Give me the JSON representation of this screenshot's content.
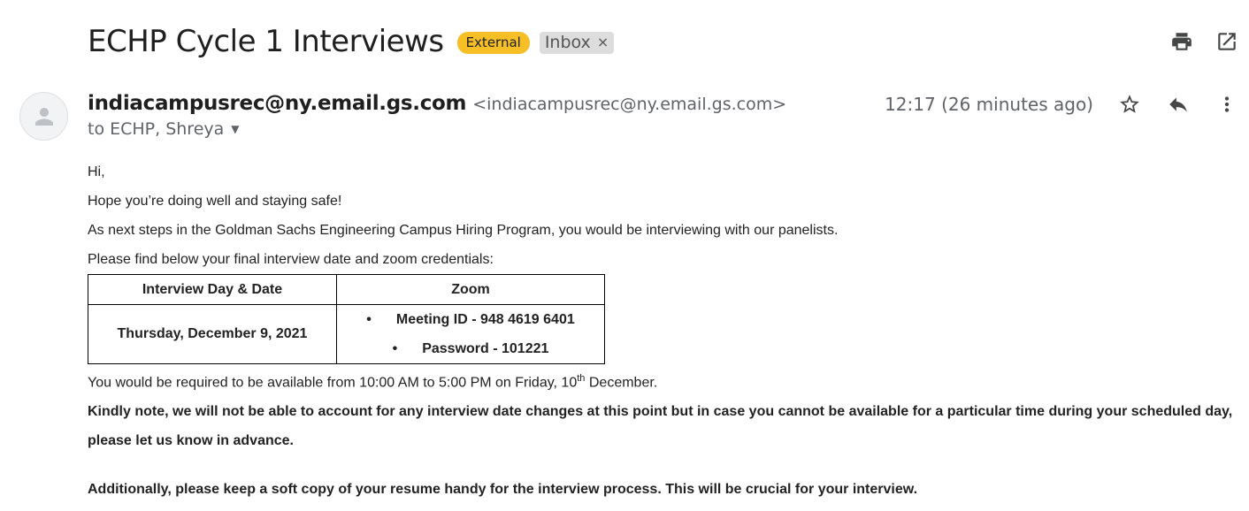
{
  "email": {
    "subject": "ECHP Cycle 1 Interviews",
    "labels": {
      "external": "External",
      "inbox": "Inbox",
      "inbox_remove": "×"
    },
    "sender_name": "indiacampusrec@ny.email.gs.com",
    "sender_email": "<indiacampusrec@ny.email.gs.com>",
    "recipients": "to ECHP, Shreya",
    "time": "12:17 (26 minutes ago)"
  },
  "icons": {
    "print": "print-icon",
    "open_new_window": "open-in-new-window-icon",
    "star": "star-icon",
    "reply": "reply-icon",
    "more": "more-vert-icon",
    "avatar": "person-icon",
    "recipients_caret": "chevron-down-icon"
  },
  "body": {
    "greeting": "Hi,",
    "line1": "Hope you’re doing well and staying safe!",
    "line2": "As next steps in the Goldman Sachs Engineering Campus Hiring Program, you would be interviewing with our panelists.",
    "line3": "Please find below your final interview date and zoom credentials:",
    "table": {
      "header_date": "Interview Day & Date",
      "header_zoom": "Zoom",
      "date": "Thursday, December 9, 2021",
      "bullet": "•",
      "meeting": "Meeting ID - 948 4619 6401",
      "password": "Password - 101221"
    },
    "avail_pre": "You would be required to be available from 10:00 AM to 5:00 PM on Friday, 10",
    "avail_sup": "th",
    "avail_post": " December.",
    "note": "Kindly note, we will not be able to account for any interview date changes at this point but in case you cannot be available for a particular time during your scheduled day, please let us know in advance.",
    "resume": "Additionally, please keep a soft copy of your resume handy for the interview process. This will be crucial for your interview."
  }
}
